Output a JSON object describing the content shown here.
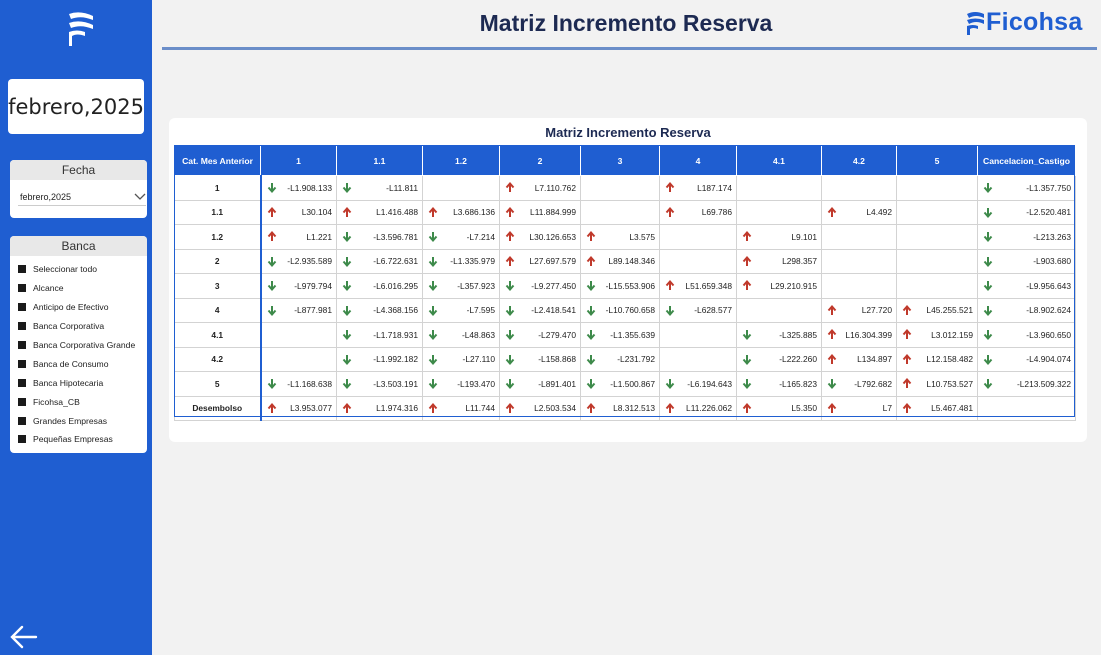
{
  "header": {
    "title": "Matriz Incremento Reserva",
    "brand": "Ficohsa"
  },
  "sidebar": {
    "period": "febrero,2025",
    "fecha": {
      "title": "Fecha",
      "selected": "febrero,2025"
    },
    "banca": {
      "title": "Banca",
      "items": [
        "Seleccionar todo",
        "Alcance",
        "Anticipo de Efectivo",
        "Banca Corporativa",
        "Banca Corporativa Grande",
        "Banca de Consumo",
        "Banca Hipotecaria",
        "Ficohsa_CB",
        "Grandes Empresas",
        "Pequeñas Empresas"
      ]
    }
  },
  "colors": {
    "primary": "#1f5ed1",
    "up": "#c0392b",
    "down": "#3d8a4a",
    "title": "#1d2a52"
  },
  "matrix": {
    "title": "Matriz Incremento Reserva",
    "columns": [
      "Cat. Mes Anterior",
      "1",
      "1.1",
      "1.2",
      "2",
      "3",
      "4",
      "4.1",
      "4.2",
      "5",
      "Cancelacion_Castigo"
    ],
    "rows": [
      {
        "label": "1",
        "cells": [
          {
            "dir": "down",
            "v": "-L1.908.133"
          },
          {
            "dir": "down",
            "v": "-L11.811"
          },
          {
            "dir": "",
            "v": ""
          },
          {
            "dir": "up",
            "v": "L7.110.762"
          },
          {
            "dir": "",
            "v": ""
          },
          {
            "dir": "up",
            "v": "L187.174"
          },
          {
            "dir": "",
            "v": ""
          },
          {
            "dir": "",
            "v": ""
          },
          {
            "dir": "",
            "v": ""
          },
          {
            "dir": "down",
            "v": "-L1.357.750"
          }
        ]
      },
      {
        "label": "1.1",
        "cells": [
          {
            "dir": "up",
            "v": "L30.104"
          },
          {
            "dir": "up",
            "v": "L1.416.488"
          },
          {
            "dir": "up",
            "v": "L3.686.136"
          },
          {
            "dir": "up",
            "v": "L11.884.999"
          },
          {
            "dir": "",
            "v": ""
          },
          {
            "dir": "up",
            "v": "L69.786"
          },
          {
            "dir": "",
            "v": ""
          },
          {
            "dir": "up",
            "v": "L4.492"
          },
          {
            "dir": "",
            "v": ""
          },
          {
            "dir": "down",
            "v": "-L2.520.481"
          }
        ]
      },
      {
        "label": "1.2",
        "cells": [
          {
            "dir": "up",
            "v": "L1.221"
          },
          {
            "dir": "down",
            "v": "-L3.596.781"
          },
          {
            "dir": "down",
            "v": "-L7.214"
          },
          {
            "dir": "up",
            "v": "L30.126.653"
          },
          {
            "dir": "up",
            "v": "L3.575"
          },
          {
            "dir": "",
            "v": ""
          },
          {
            "dir": "up",
            "v": "L9.101"
          },
          {
            "dir": "",
            "v": ""
          },
          {
            "dir": "",
            "v": ""
          },
          {
            "dir": "down",
            "v": "-L213.263"
          }
        ]
      },
      {
        "label": "2",
        "cells": [
          {
            "dir": "down",
            "v": "-L2.935.589"
          },
          {
            "dir": "down",
            "v": "-L6.722.631"
          },
          {
            "dir": "down",
            "v": "-L1.335.979"
          },
          {
            "dir": "up",
            "v": "L27.697.579"
          },
          {
            "dir": "up",
            "v": "L89.148.346"
          },
          {
            "dir": "",
            "v": ""
          },
          {
            "dir": "up",
            "v": "L298.357"
          },
          {
            "dir": "",
            "v": ""
          },
          {
            "dir": "",
            "v": ""
          },
          {
            "dir": "down",
            "v": "-L903.680"
          }
        ]
      },
      {
        "label": "3",
        "cells": [
          {
            "dir": "down",
            "v": "-L979.794"
          },
          {
            "dir": "down",
            "v": "-L6.016.295"
          },
          {
            "dir": "down",
            "v": "-L357.923"
          },
          {
            "dir": "down",
            "v": "-L9.277.450"
          },
          {
            "dir": "down",
            "v": "-L15.553.906"
          },
          {
            "dir": "up",
            "v": "L51.659.348"
          },
          {
            "dir": "up",
            "v": "L29.210.915"
          },
          {
            "dir": "",
            "v": ""
          },
          {
            "dir": "",
            "v": ""
          },
          {
            "dir": "down",
            "v": "-L9.956.643"
          }
        ]
      },
      {
        "label": "4",
        "cells": [
          {
            "dir": "down",
            "v": "-L877.981"
          },
          {
            "dir": "down",
            "v": "-L4.368.156"
          },
          {
            "dir": "down",
            "v": "-L7.595"
          },
          {
            "dir": "down",
            "v": "-L2.418.541"
          },
          {
            "dir": "down",
            "v": "-L10.760.658"
          },
          {
            "dir": "down",
            "v": "-L628.577"
          },
          {
            "dir": "",
            "v": ""
          },
          {
            "dir": "up",
            "v": "L27.720"
          },
          {
            "dir": "up",
            "v": "L45.255.521"
          },
          {
            "dir": "down",
            "v": "-L8.902.624"
          }
        ]
      },
      {
        "label": "4.1",
        "cells": [
          {
            "dir": "",
            "v": ""
          },
          {
            "dir": "down",
            "v": "-L1.718.931"
          },
          {
            "dir": "down",
            "v": "-L48.863"
          },
          {
            "dir": "down",
            "v": "-L279.470"
          },
          {
            "dir": "down",
            "v": "-L1.355.639"
          },
          {
            "dir": "",
            "v": ""
          },
          {
            "dir": "down",
            "v": "-L325.885"
          },
          {
            "dir": "up",
            "v": "L16.304.399"
          },
          {
            "dir": "up",
            "v": "L3.012.159"
          },
          {
            "dir": "down",
            "v": "-L3.960.650"
          }
        ]
      },
      {
        "label": "4.2",
        "cells": [
          {
            "dir": "",
            "v": ""
          },
          {
            "dir": "down",
            "v": "-L1.992.182"
          },
          {
            "dir": "down",
            "v": "-L27.110"
          },
          {
            "dir": "down",
            "v": "-L158.868"
          },
          {
            "dir": "down",
            "v": "-L231.792"
          },
          {
            "dir": "",
            "v": ""
          },
          {
            "dir": "down",
            "v": "-L222.260"
          },
          {
            "dir": "up",
            "v": "L134.897"
          },
          {
            "dir": "up",
            "v": "L12.158.482"
          },
          {
            "dir": "down",
            "v": "-L4.904.074"
          }
        ]
      },
      {
        "label": "5",
        "cells": [
          {
            "dir": "down",
            "v": "-L1.168.638"
          },
          {
            "dir": "down",
            "v": "-L3.503.191"
          },
          {
            "dir": "down",
            "v": "-L193.470"
          },
          {
            "dir": "down",
            "v": "-L891.401"
          },
          {
            "dir": "down",
            "v": "-L1.500.867"
          },
          {
            "dir": "down",
            "v": "-L6.194.643"
          },
          {
            "dir": "down",
            "v": "-L165.823"
          },
          {
            "dir": "down",
            "v": "-L792.682"
          },
          {
            "dir": "up",
            "v": "L10.753.527"
          },
          {
            "dir": "down",
            "v": "-L213.509.322"
          }
        ]
      },
      {
        "label": "Desembolso",
        "cells": [
          {
            "dir": "up",
            "v": "L3.953.077"
          },
          {
            "dir": "up",
            "v": "L1.974.316"
          },
          {
            "dir": "up",
            "v": "L11.744"
          },
          {
            "dir": "up",
            "v": "L2.503.534"
          },
          {
            "dir": "up",
            "v": "L8.312.513"
          },
          {
            "dir": "up",
            "v": "L11.226.062"
          },
          {
            "dir": "up",
            "v": "L5.350"
          },
          {
            "dir": "up",
            "v": "L7"
          },
          {
            "dir": "up",
            "v": "L5.467.481"
          },
          {
            "dir": "",
            "v": ""
          }
        ]
      }
    ]
  }
}
